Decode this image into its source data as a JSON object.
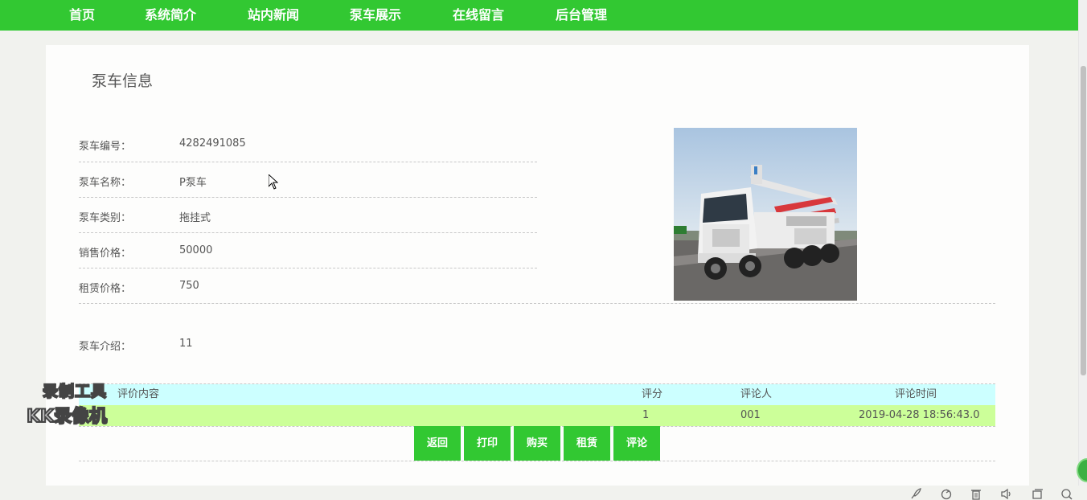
{
  "nav": {
    "items": [
      "首页",
      "系统简介",
      "站内新闻",
      "泵车展示",
      "在线留言",
      "后台管理"
    ]
  },
  "page": {
    "title": "泵车信息"
  },
  "details": {
    "rows": [
      {
        "label": "泵车编号：",
        "value": "4282491085"
      },
      {
        "label": "泵车名称：",
        "value": "P泵车"
      },
      {
        "label": "泵车类别：",
        "value": "拖挂式"
      },
      {
        "label": "销售价格：",
        "value": "50000"
      },
      {
        "label": "租赁价格：",
        "value": "750"
      }
    ],
    "intro": {
      "label": "泵车介绍：",
      "value": "11"
    }
  },
  "comments": {
    "headers": {
      "content": "评价内容",
      "score": "评分",
      "author": "评论人",
      "time": "评论时间"
    },
    "rows": [
      {
        "content": "",
        "score": "1",
        "author": "001",
        "time": "2019-04-28 18:56:43.0"
      }
    ]
  },
  "actions": {
    "back": "返回",
    "print": "打印",
    "buy": "购买",
    "rent": "租赁",
    "comment": "评论"
  },
  "watermark": {
    "line1": "录制工具",
    "line2": "KK录像机"
  },
  "colors": {
    "nav_green": "#32c832",
    "table_header": "#ccffff",
    "table_row": "#ccff99"
  }
}
